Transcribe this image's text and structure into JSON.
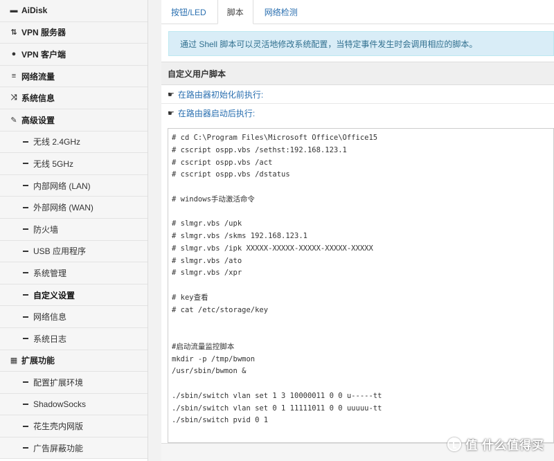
{
  "sidebar": {
    "items": [
      {
        "label": "AiDisk",
        "icon": "disk-icon",
        "glyph": "▬",
        "type": "top"
      },
      {
        "label": "VPN 服务器",
        "icon": "vpn-server-icon",
        "glyph": "⇅",
        "type": "top"
      },
      {
        "label": "VPN 客户端",
        "icon": "globe-icon",
        "glyph": "●",
        "type": "top"
      },
      {
        "label": "网络流量",
        "icon": "list-icon",
        "glyph": "≡",
        "type": "top"
      },
      {
        "label": "系统信息",
        "icon": "random-icon",
        "glyph": "⤨",
        "type": "top"
      },
      {
        "label": "高级设置",
        "icon": "wrench-icon",
        "glyph": "✎",
        "type": "top"
      },
      {
        "label": "无线 2.4GHz",
        "type": "sub"
      },
      {
        "label": "无线 5GHz",
        "type": "sub"
      },
      {
        "label": "内部网络 (LAN)",
        "type": "sub"
      },
      {
        "label": "外部网络 (WAN)",
        "type": "sub"
      },
      {
        "label": "防火墙",
        "type": "sub"
      },
      {
        "label": "USB 应用程序",
        "type": "sub"
      },
      {
        "label": "系统管理",
        "type": "sub"
      },
      {
        "label": "自定义设置",
        "type": "sub",
        "active": true
      },
      {
        "label": "网络信息",
        "type": "sub"
      },
      {
        "label": "系统日志",
        "type": "sub"
      },
      {
        "label": "扩展功能",
        "icon": "grid-icon",
        "glyph": "▦",
        "type": "top"
      },
      {
        "label": "配置扩展环境",
        "type": "sub"
      },
      {
        "label": "ShadowSocks",
        "type": "sub"
      },
      {
        "label": "花生壳内网版",
        "type": "sub"
      },
      {
        "label": "广告屏蔽功能",
        "type": "sub"
      }
    ]
  },
  "tabs": [
    {
      "label": "按钮/LED",
      "active": false
    },
    {
      "label": "脚本",
      "active": true
    },
    {
      "label": "网络检测",
      "active": false
    }
  ],
  "info": "通过 Shell 脚本可以灵活地修改系统配置，当特定事件发生时会调用相应的脚本。",
  "section_title": "自定义用户脚本",
  "row1_label": "在路由器初始化前执行:",
  "row2_label": "在路由器启动后执行:",
  "script_lines": [
    "# cd C:\\Program Files\\Microsoft Office\\Office15",
    "# cscript ospp.vbs /sethst:192.168.123.1",
    "# cscript ospp.vbs /act",
    "# cscript ospp.vbs /dstatus",
    "",
    "# windows手动激活命令",
    "",
    "# slmgr.vbs /upk",
    "# slmgr.vbs /skms 192.168.123.1",
    "# slmgr.vbs /ipk XXXXX-XXXXX-XXXXX-XXXXX-XXXXX",
    "# slmgr.vbs /ato",
    "# slmgr.vbs /xpr",
    "",
    "# key查看",
    "# cat /etc/storage/key",
    "",
    "",
    "#启动流量监控脚本",
    "mkdir -p /tmp/bwmon",
    "/usr/sbin/bwmon &",
    "",
    "./sbin/switch vlan set 1 3 10000011 0 0 u-----tt",
    "./sbin/switch vlan set 0 1 11111011 0 0 uuuuu-tt",
    "./sbin/switch pvid 0 1"
  ],
  "watermark": "值 什么值得买"
}
